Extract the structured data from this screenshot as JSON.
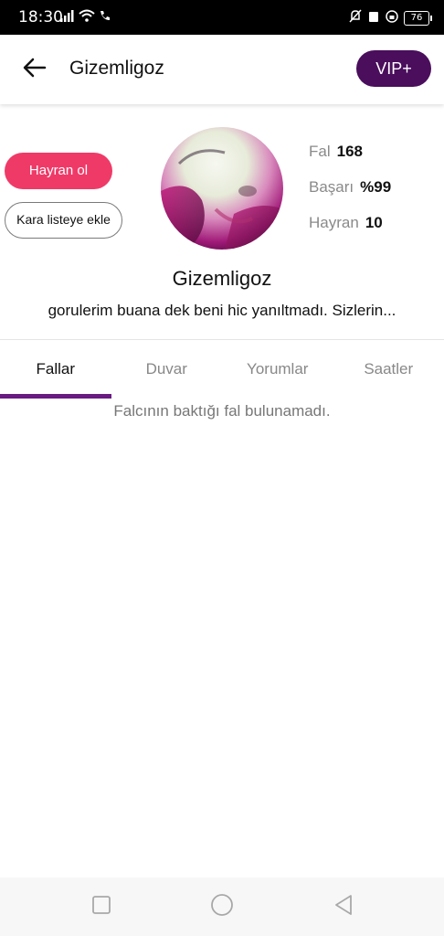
{
  "status_bar": {
    "time": "18:30",
    "battery": "76",
    "icons": [
      "signal-icon",
      "wifi-icon",
      "wifi-call-icon",
      "mute-icon",
      "no-sim-icon",
      "vpn-icon",
      "battery-icon"
    ]
  },
  "app_bar": {
    "title": "Gizemligoz",
    "vip_label": "VIP+",
    "back_icon": "arrow-left-icon"
  },
  "colors": {
    "vip": "#4a0e5c",
    "follow": "#ef3a68",
    "tab_indicator": "#6a1b82"
  },
  "profile": {
    "follow_label": "Hayran ol",
    "blacklist_label": "Kara listeye ekle",
    "username": "Gizemligoz",
    "bio": "gorulerim buana dek beni hic yanıltmadı. Sizlerin...",
    "stats": [
      {
        "label": "Fal",
        "value": "168"
      },
      {
        "label": "Başarı",
        "value": "%99"
      },
      {
        "label": "Hayran",
        "value": "10"
      }
    ]
  },
  "tabs": [
    {
      "label": "Fallar",
      "active": true
    },
    {
      "label": "Duvar",
      "active": false
    },
    {
      "label": "Yorumlar",
      "active": false
    },
    {
      "label": "Saatler",
      "active": false
    }
  ],
  "empty_message": "Falcının baktığı fal bulunamadı.",
  "nav_bar": {
    "icons": [
      "recent-apps-icon",
      "home-icon",
      "back-icon"
    ]
  }
}
